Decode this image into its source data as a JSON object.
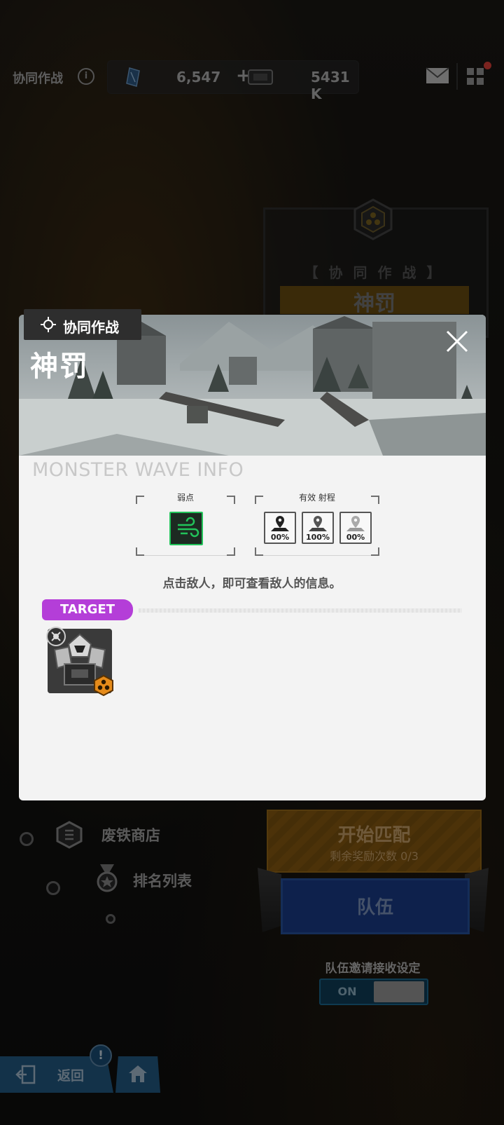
{
  "topbar": {
    "title": "协同作战",
    "resource_1": "6,547",
    "resource_2": "5431 K",
    "icons": [
      "info-icon",
      "crystal-icon",
      "ticket-icon",
      "mail-icon",
      "grid-menu-icon"
    ]
  },
  "background_panel": {
    "subtitle": "【 协 同 作 战 】",
    "title": "神罚"
  },
  "modal": {
    "tag_label": "协同作战",
    "stage_title": "神罚",
    "section_heading": "MONSTER WAVE INFO",
    "weakness_label": "弱点",
    "effective_range_label": "有效 射程",
    "range_values": [
      "00%",
      "100%",
      "00%"
    ],
    "hint": "点击敌人，即可查看敌人的信息。",
    "target_label": "TARGET"
  },
  "bottom": {
    "store_label": "废铁商店",
    "ranking_label": "排名列表",
    "match_label": "开始匹配",
    "match_sub": "剩余奖励次数 0/3",
    "team_label": "队伍",
    "invite_setting_label": "队伍邀请接收设定",
    "toggle_state": "ON",
    "back_label": "返回",
    "notice_badge": "!"
  },
  "colors": {
    "accent_orange": "#8b5c12",
    "target_purple": "#b43ed8",
    "weakness_green": "#22c35a",
    "team_blue": "#1a3d8a"
  }
}
